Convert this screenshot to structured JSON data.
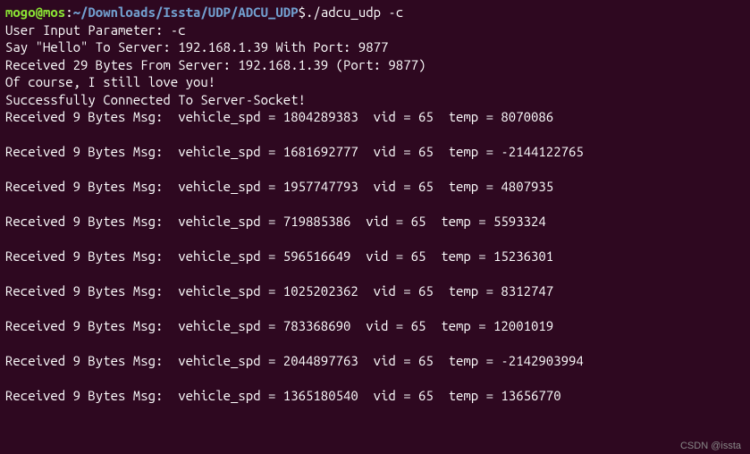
{
  "prompt": {
    "user_host": "mogo@mos",
    "colon": ":",
    "path": "~/Downloads/Issta/UDP/ADCU_UDP",
    "dollar": "$ ",
    "command": "./adcu_udp -c"
  },
  "lines": {
    "l1": "User Input Parameter: -c",
    "l2": "Say \"Hello\" To Server: 192.168.1.39 With Port: 9877",
    "l3": "Received 29 Bytes From Server: 192.168.1.39 (Port: 9877)",
    "l4": "Of course, I still love you!",
    "l5": "Successfully Connected To Server-Socket!"
  },
  "messages": [
    {
      "vehicle_spd": "1804289383",
      "vid": "65",
      "temp": "8070086"
    },
    {
      "vehicle_spd": "1681692777",
      "vid": "65",
      "temp": "-2144122765"
    },
    {
      "vehicle_spd": "1957747793",
      "vid": "65",
      "temp": "4807935"
    },
    {
      "vehicle_spd": "719885386",
      "vid": "65",
      "temp": "5593324"
    },
    {
      "vehicle_spd": "596516649",
      "vid": "65",
      "temp": "15236301"
    },
    {
      "vehicle_spd": "1025202362",
      "vid": "65",
      "temp": "8312747"
    },
    {
      "vehicle_spd": "783368690",
      "vid": "65",
      "temp": "12001019"
    },
    {
      "vehicle_spd": "2044897763",
      "vid": "65",
      "temp": "-2142903994"
    },
    {
      "vehicle_spd": "1365180540",
      "vid": "65",
      "temp": "13656770"
    }
  ],
  "msg_template": {
    "prefix": "Received 9 Bytes Msg:  vehicle_spd = ",
    "vid_part": "  vid = ",
    "temp_part": "  temp = "
  },
  "watermark": "CSDN @issta"
}
